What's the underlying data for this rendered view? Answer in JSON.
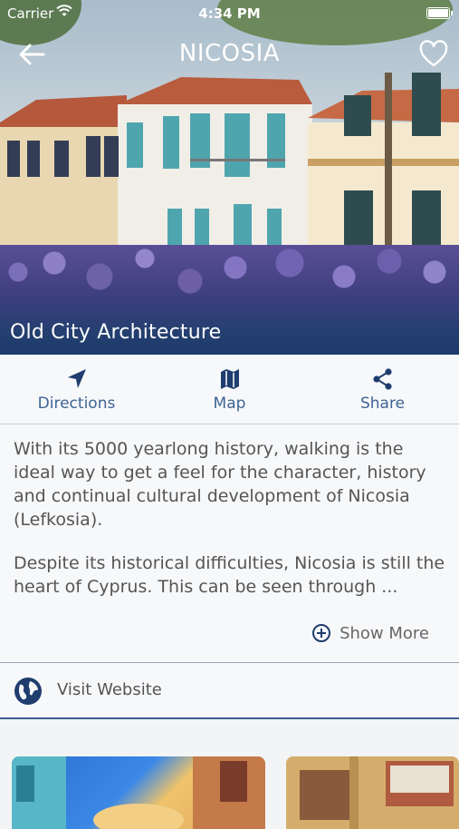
{
  "status": {
    "carrier": "Carrier",
    "time": "4:34 PM"
  },
  "nav": {
    "title": "NICOSIA"
  },
  "hero": {
    "caption": "Old City Architecture"
  },
  "actions": [
    {
      "label": "Directions",
      "icon": "navigation-arrow-icon"
    },
    {
      "label": "Map",
      "icon": "map-icon"
    },
    {
      "label": "Share",
      "icon": "share-icon"
    }
  ],
  "description": {
    "paragraph1": "With its 5000 yearlong history, walking is the ideal way to get a feel for the character, history and continual cultural development of Nicosia (Lefkosia).",
    "paragraph2": "Despite its historical difficulties, Nicosia is still the heart of Cyprus. This can be seen through ...",
    "show_more": "Show More"
  },
  "website": {
    "label": "Visit Website",
    "icon": "globe-icon"
  },
  "colors": {
    "accent": "#3e6494",
    "hero_overlay": "#1f3d6e",
    "divider": "#3a5f8e"
  }
}
